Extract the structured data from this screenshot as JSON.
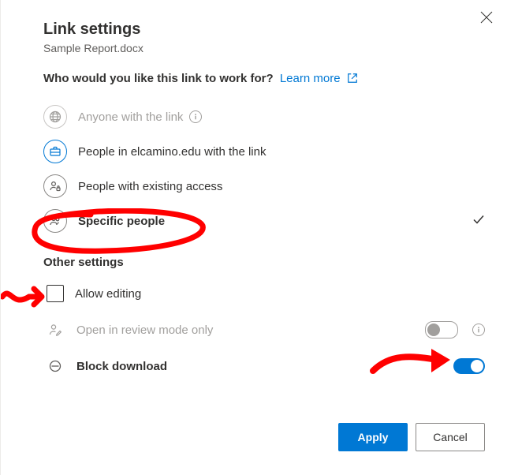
{
  "header": {
    "title": "Link settings",
    "filename": "Sample Report.docx"
  },
  "prompt": {
    "question": "Who would you like this link to work for?",
    "learn_more": "Learn more"
  },
  "options": {
    "anyone": "Anyone with the link",
    "org": "People in elcamino.edu with the link",
    "existing": "People with existing access",
    "specific": "Specific people"
  },
  "other": {
    "heading": "Other settings",
    "allow_editing": "Allow editing",
    "review_mode": "Open in review mode only",
    "block_download": "Block download"
  },
  "buttons": {
    "apply": "Apply",
    "cancel": "Cancel"
  }
}
